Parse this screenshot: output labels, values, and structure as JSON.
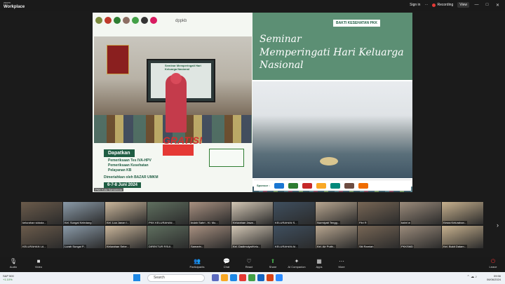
{
  "app": {
    "brand_line1": "zoom",
    "brand_line2": "Workplace"
  },
  "topbar": {
    "signin": "Sign in",
    "recording": "Recording",
    "view": "View"
  },
  "window_controls": {
    "minimize": "—",
    "maximize": "□",
    "close": "✕",
    "more": "⋯"
  },
  "shared": {
    "left": {
      "logo_text": "dppkb",
      "dapatkan": "Dapatkan",
      "items": [
        "Pemeriksaan Tes IVA-HPV",
        "Pemeriksaan Kesehatan",
        "Pelayanan KB"
      ],
      "bazar": "Dimeriahkan oleh BAZAR UMKM",
      "date": "6-7-8 Juni 2024",
      "gratis": "GRATIS!"
    },
    "right": {
      "bakti": "BAKTI KESEHATAN PKK",
      "seminar": "Seminar",
      "title": "Memperingati Hari Keluarga Nasional",
      "sponsor_label": "Sponsor :"
    }
  },
  "presenter_name": "PKK Kota Samarinda",
  "participants": [
    {
      "name": "kelurahan sidoda..."
    },
    {
      "name": "Kel. Sungai Keledang"
    },
    {
      "name": "Kel. Loa Janan I..."
    },
    {
      "name": "PKK KELURAHAN..."
    },
    {
      "name": "Indah Sahri - Kl. Mu..."
    },
    {
      "name": "Kelurahan Jawa..."
    },
    {
      "name": "KELURAHAN S..."
    },
    {
      "name": "Nurmiyati Tengg..."
    },
    {
      "name": "Fitri R"
    },
    {
      "name": "bahri w"
    },
    {
      "name": "Kesra Kelurahan..."
    },
    {
      "name": "KELURAHAN LA..."
    },
    {
      "name": "Lurah Sungai P..."
    },
    {
      "name": "Kelurahan Sebe..."
    },
    {
      "name": "DIREKTUR RSUI..."
    },
    {
      "name": "Samarin..."
    },
    {
      "name": "Kel. Dadimulya/Kelu..."
    },
    {
      "name": "KELURAHAN AI..."
    },
    {
      "name": "Kel. Air Putih..."
    },
    {
      "name": "Siti Ramlah"
    },
    {
      "name": "PKKSMD"
    },
    {
      "name": "Kel. Bukit Dalam..."
    }
  ],
  "controls": {
    "audio": "Audio",
    "video": "Video",
    "participants": "Participants",
    "participants_count": "58",
    "chat": "Chat",
    "react": "React",
    "share": "Share",
    "companion": "AI Companion",
    "apps": "Apps",
    "more": "More",
    "leave": "Leave"
  },
  "taskbar": {
    "weather_label": "S&P 500",
    "weather_value": "+1.10%",
    "search_placeholder": "Search",
    "time": "09:56",
    "date": "06/06/2024"
  },
  "colors": {
    "accent_green": "#1f5d43",
    "record_red": "#e53935",
    "leave_red": "#d32f2f"
  }
}
